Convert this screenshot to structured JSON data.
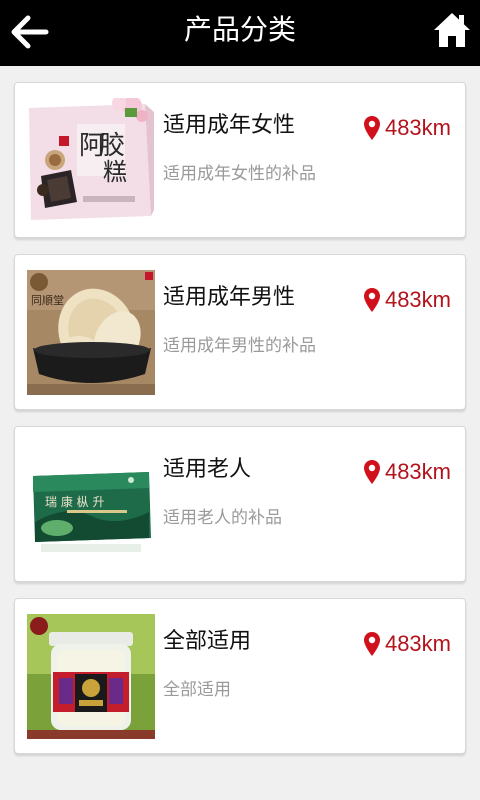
{
  "header": {
    "title": "产品分类",
    "back_icon": "arrow-left-icon",
    "home_icon": "home-icon"
  },
  "colors": {
    "header_bg": "#000000",
    "distance": "#b3141c",
    "pin": "#d0111b"
  },
  "categories": [
    {
      "name": "适用成年女性",
      "desc": "适用成年女性的补品",
      "distance": "483km",
      "image": "ejiao-cake-box"
    },
    {
      "name": "适用成年男性",
      "desc": "适用成年男性的补品",
      "distance": "483km",
      "image": "deer-antler-slices-bowl"
    },
    {
      "name": "适用老人",
      "desc": "适用老人的补品",
      "distance": "483km",
      "image": "tea-gift-box"
    },
    {
      "name": "全部适用",
      "desc": "全部适用",
      "distance": "483km",
      "image": "birds-nest-jar"
    }
  ]
}
